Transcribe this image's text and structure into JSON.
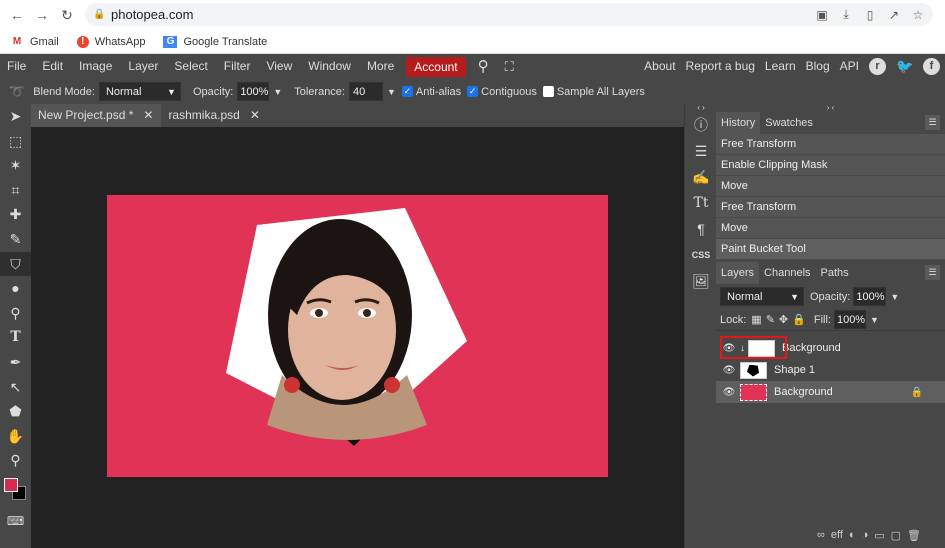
{
  "browser": {
    "url": "photopea.com",
    "bookmarks": [
      {
        "label": "Gmail",
        "icon": "gmail-icon"
      },
      {
        "label": "WhatsApp",
        "icon": "whatsapp-icon"
      },
      {
        "label": "Google Translate",
        "icon": "translate-icon"
      }
    ]
  },
  "menu": {
    "items": [
      "File",
      "Edit",
      "Image",
      "Layer",
      "Select",
      "Filter",
      "View",
      "Window",
      "More"
    ],
    "account": "Account",
    "right": [
      "About",
      "Report a bug",
      "Learn",
      "Blog",
      "API"
    ]
  },
  "options": {
    "blend_label": "Blend Mode:",
    "blend_value": "Normal",
    "opacity_label": "Opacity:",
    "opacity_value": "100%",
    "tolerance_label": "Tolerance:",
    "tolerance_value": "40",
    "antialias": "Anti-alias",
    "contiguous": "Contiguous",
    "sample_all": "Sample All Layers"
  },
  "tabs": [
    {
      "label": "New Project.psd *"
    },
    {
      "label": "rashmika.psd"
    }
  ],
  "history": {
    "tabs": [
      "History",
      "Swatches"
    ],
    "items": [
      "Free Transform",
      "Enable Clipping Mask",
      "Move",
      "Free Transform",
      "Move",
      "Paint Bucket Tool"
    ]
  },
  "layers": {
    "tabs": [
      "Layers",
      "Channels",
      "Paths"
    ],
    "blend": "Normal",
    "opacity_label": "Opacity:",
    "opacity_value": "100%",
    "lock_label": "Lock:",
    "fill_label": "Fill:",
    "fill_value": "100%",
    "items": [
      {
        "name": "Background"
      },
      {
        "name": "Shape 1"
      },
      {
        "name": "Background"
      }
    ]
  },
  "colors": {
    "accent": "#b71c1c",
    "canvas": "#e03355",
    "foreground": "#d72b4f",
    "background_swatch": "#000000"
  }
}
